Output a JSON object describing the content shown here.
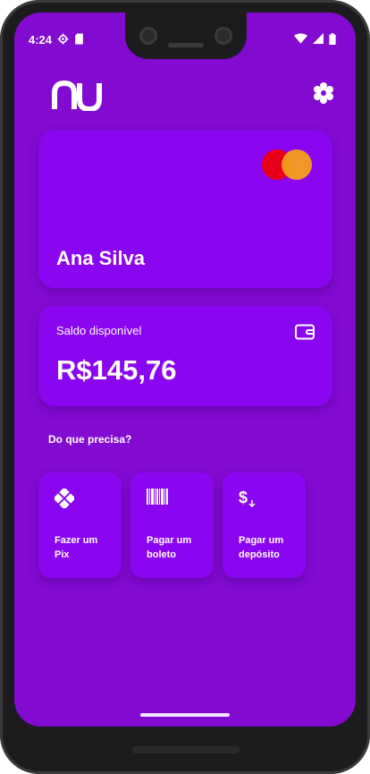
{
  "status_bar": {
    "time": "4:24",
    "left_icons": [
      "settings-gear-icon",
      "sd-card-icon"
    ],
    "right_icons": [
      "wifi-icon",
      "signal-icon",
      "battery-icon"
    ]
  },
  "header": {
    "logo_text": "nu",
    "settings_icon": "gear-icon"
  },
  "card": {
    "holder_name": "Ana Silva",
    "brand": "mastercard",
    "colors": {
      "circle_left": "#eb001b",
      "circle_right": "#f79e1b"
    }
  },
  "balance": {
    "label": "Saldo disponível",
    "value": "R$145,76",
    "icon": "wallet-icon"
  },
  "actions_section": {
    "title": "Do que precisa?",
    "items": [
      {
        "icon": "pix-icon",
        "label": "Fazer um Pix"
      },
      {
        "icon": "barcode-icon",
        "label": "Pagar um boleto"
      },
      {
        "icon": "deposit-icon",
        "label": "Pagar um depósito"
      }
    ]
  },
  "colors": {
    "background": "#820ad1",
    "card": "#8a05f0",
    "text": "#ffffff"
  }
}
